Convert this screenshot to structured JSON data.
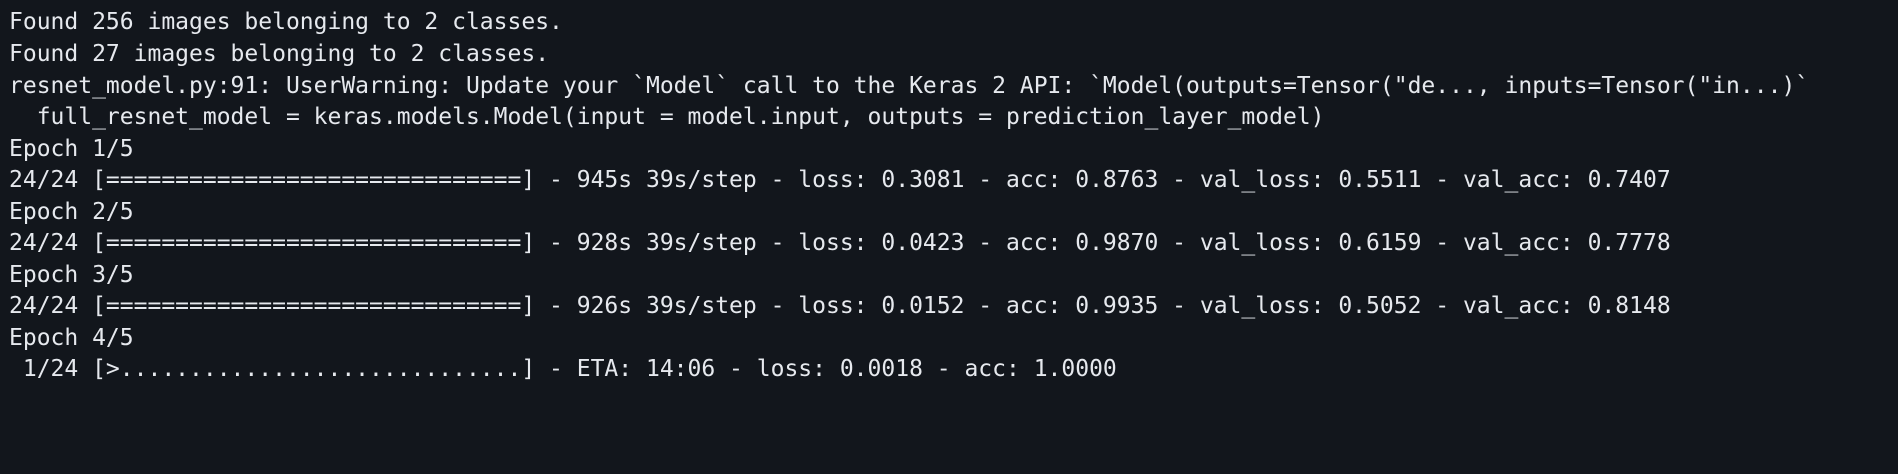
{
  "terminal": {
    "lines": [
      "Found 256 images belonging to 2 classes.",
      "Found 27 images belonging to 2 classes.",
      "resnet_model.py:91: UserWarning: Update your `Model` call to the Keras 2 API: `Model(outputs=Tensor(\"de..., inputs=Tensor(\"in...)`",
      "  full_resnet_model = keras.models.Model(input = model.input, outputs = prediction_layer_model)",
      "Epoch 1/5",
      "24/24 [==============================] - 945s 39s/step - loss: 0.3081 - acc: 0.8763 - val_loss: 0.5511 - val_acc: 0.7407",
      "Epoch 2/5",
      "24/24 [==============================] - 928s 39s/step - loss: 0.0423 - acc: 0.9870 - val_loss: 0.6159 - val_acc: 0.7778",
      "Epoch 3/5",
      "24/24 [==============================] - 926s 39s/step - loss: 0.0152 - acc: 0.9935 - val_loss: 0.5052 - val_acc: 0.8148",
      "Epoch 4/5",
      " 1/24 [>.............................] - ETA: 14:06 - loss: 0.0018 - acc: 1.0000"
    ]
  }
}
